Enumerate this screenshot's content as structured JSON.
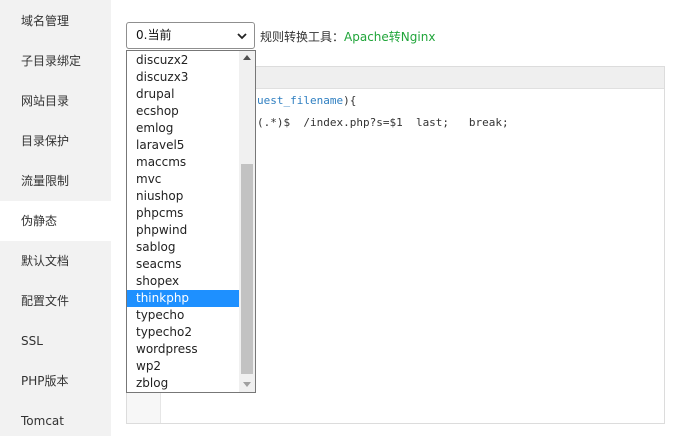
{
  "sidebar": {
    "items": [
      {
        "label": "域名管理"
      },
      {
        "label": "子目录绑定"
      },
      {
        "label": "网站目录"
      },
      {
        "label": "目录保护"
      },
      {
        "label": "流量限制"
      },
      {
        "label": "伪静态",
        "active": true
      },
      {
        "label": "默认文档"
      },
      {
        "label": "配置文件"
      },
      {
        "label": "SSL"
      },
      {
        "label": "PHP版本"
      },
      {
        "label": "Tomcat"
      }
    ]
  },
  "rewrite": {
    "select_value": "0.当前",
    "tool_label": "规则转换工具：",
    "tool_link": "Apache转Nginx",
    "accent_color": "#20a53a"
  },
  "editor": {
    "line1_var": "uest_filename",
    "line1_rest": "){",
    "line2": "(.*)$  /index.php?s=$1  last;   break;"
  },
  "dropdown": {
    "options": [
      "discuzx2",
      "discuzx3",
      "drupal",
      "ecshop",
      "emlog",
      "laravel5",
      "maccms",
      "mvc",
      "niushop",
      "phpcms",
      "phpwind",
      "sablog",
      "seacms",
      "shopex",
      "thinkphp",
      "typecho",
      "typecho2",
      "wordpress",
      "wp2",
      "zblog"
    ],
    "highlighted": "thinkphp",
    "highlight_color": "#1e90ff"
  }
}
